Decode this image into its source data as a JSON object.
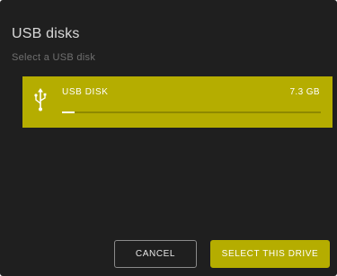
{
  "dialog": {
    "title": "USB disks",
    "subtitle": "Select a USB disk"
  },
  "disks": [
    {
      "name": "USB DISK",
      "size": "7.3 GB",
      "used_fraction": 0.05,
      "icon": "usb-icon",
      "selected": true
    }
  ],
  "actions": {
    "cancel_label": "CANCEL",
    "select_label": "SELECT THIS DRIVE"
  },
  "colors": {
    "accent": "#b5ad00",
    "background": "#1f1f1f"
  }
}
